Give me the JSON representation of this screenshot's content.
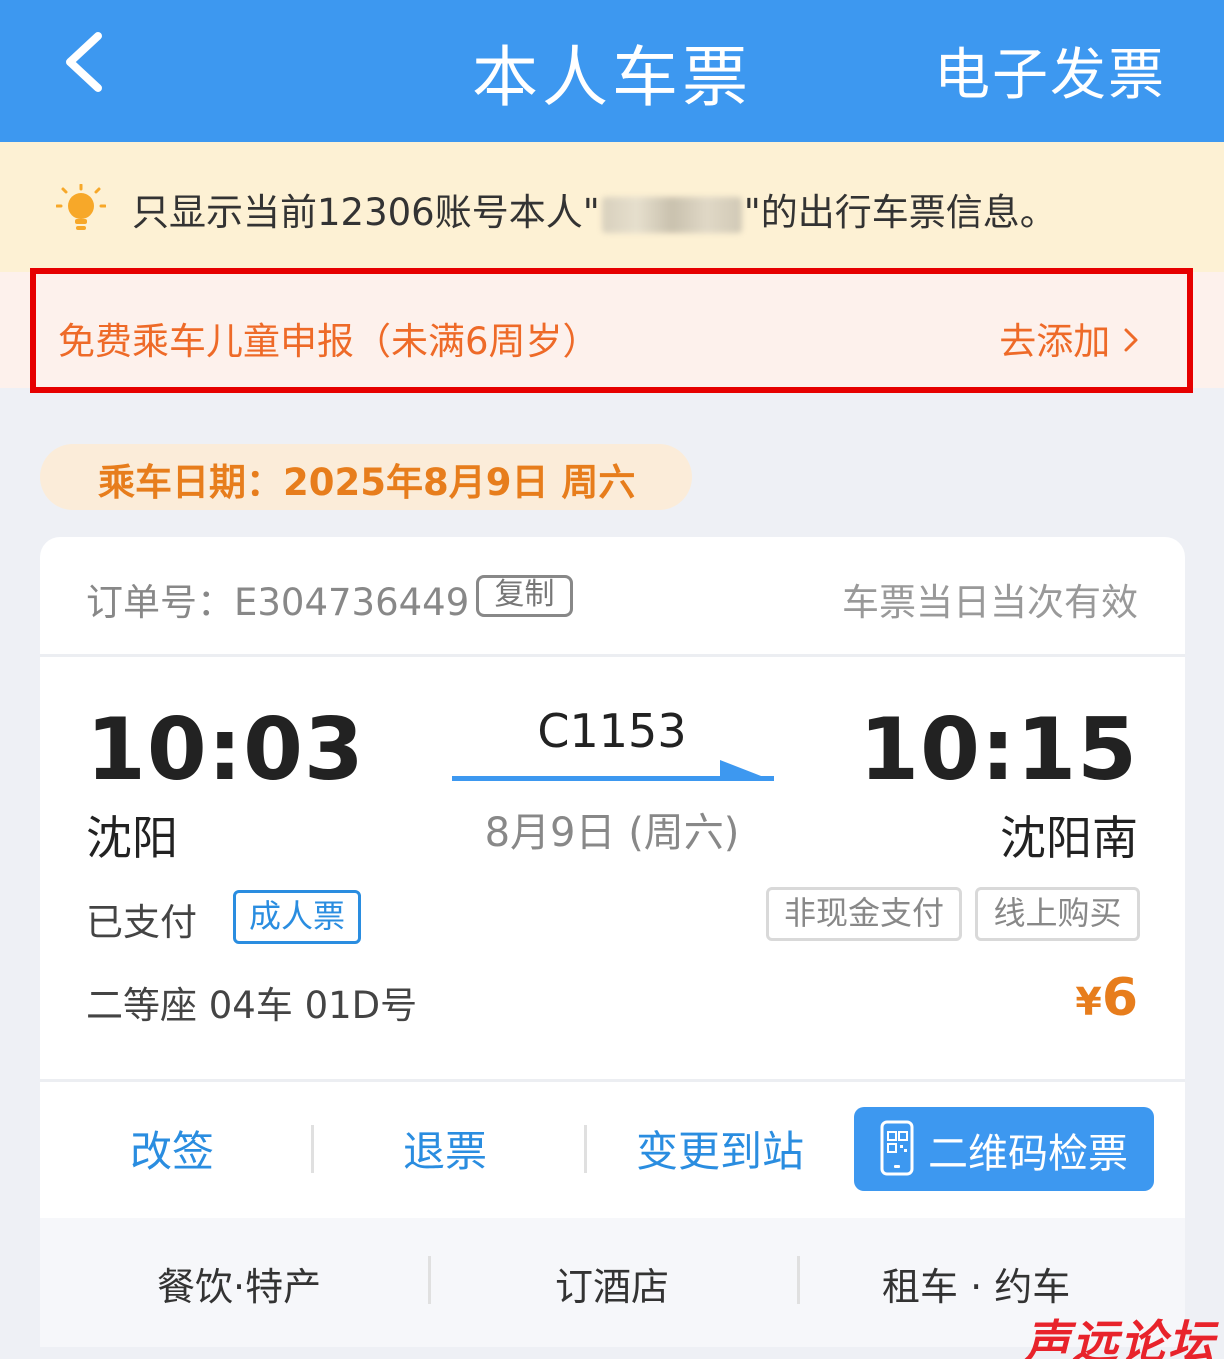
{
  "header": {
    "title": "本人车票",
    "right_action": "电子发票",
    "back_icon": "chevron-left-icon"
  },
  "notice": {
    "icon": "lightbulb-icon",
    "prefix": "只显示当前12306账号本人\"",
    "suffix": "\"的出行车票信息。"
  },
  "child_declaration": {
    "label": "免费乘车儿童申报（未满6周岁）",
    "action": "去添加",
    "highlight_color": "#e60000"
  },
  "trip_date": "乘车日期：2025年8月9日 周六",
  "ticket": {
    "order_label": "订单号：E304736449",
    "copy_label": "复制",
    "validity": "车票当日当次有效",
    "depart_time": "10:03",
    "depart_station": "沈阳",
    "arrive_time": "10:15",
    "arrive_station": "沈阳南",
    "train_number": "C1153",
    "train_date": "8月9日 (周六)",
    "payment_status": "已支付",
    "ticket_type": "成人票",
    "tags": [
      "非现金支付",
      "线上购买"
    ],
    "seat": "二等座 04车 01D号",
    "currency": "¥",
    "price": "6"
  },
  "actions": {
    "change": "改签",
    "refund": "退票",
    "change_station": "变更到站",
    "qr_check": "二维码检票"
  },
  "services": [
    "餐饮·特产",
    "订酒店",
    "租车 · 约车"
  ],
  "watermark": "声远论坛",
  "colors": {
    "brand_blue": "#3d98f0",
    "accent_orange": "#e77d1c",
    "notice_bg": "#fdf1d4"
  }
}
